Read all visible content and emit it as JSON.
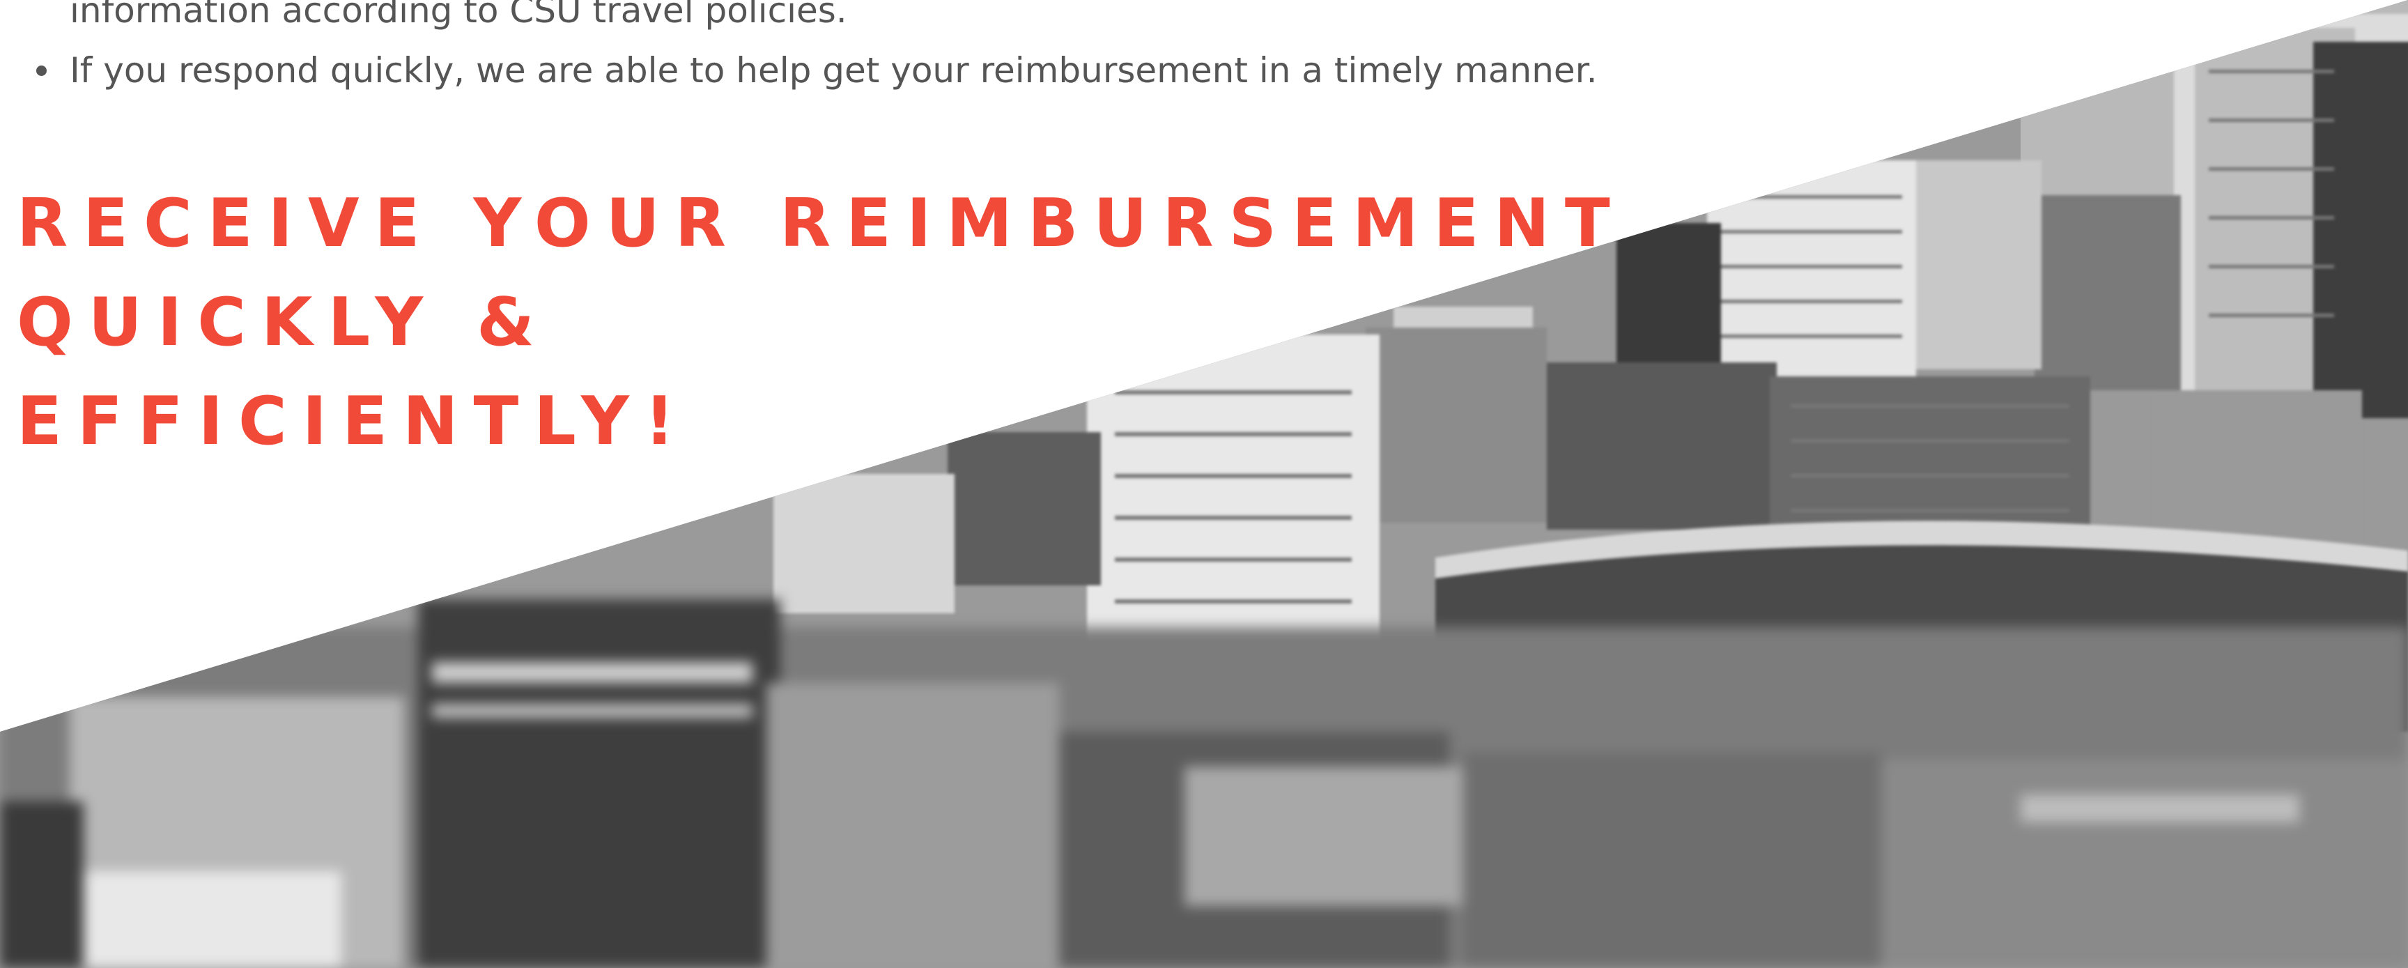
{
  "bullets": {
    "line1_continuation": "information according to CSU travel policies.",
    "line2": "If you respond quickly, we are able to help get your reimbursement in a timely manner."
  },
  "headline": {
    "line1": "RECEIVE YOUR REIMBURSEMENT",
    "line2": "QUICKLY &",
    "line3": "EFFICIENTLY!"
  },
  "colors": {
    "headline": "#f24a38",
    "body_text": "#555555",
    "background": "#ffffff"
  }
}
